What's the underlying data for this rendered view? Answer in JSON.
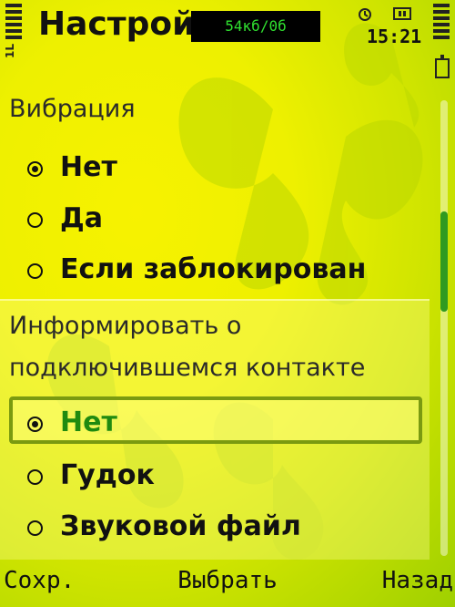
{
  "status": {
    "title": "Настройк",
    "traffic": "54кб/0б",
    "time": "15:21",
    "network": "1L"
  },
  "vibration": {
    "label": "Вибрация",
    "options": [
      {
        "label": "Нет",
        "selected": true
      },
      {
        "label": "Да",
        "selected": false
      },
      {
        "label": "Если заблокирован",
        "selected": false
      }
    ]
  },
  "notify": {
    "label_line1": "Информировать о",
    "label_line2": "подключившемся контакте",
    "options": [
      {
        "label": "Нет",
        "selected": true
      },
      {
        "label": "Гудок",
        "selected": false
      },
      {
        "label": "Звуковой файл",
        "selected": false
      }
    ]
  },
  "softkeys": {
    "left": "Сохр.",
    "middle": "Выбрать",
    "right": "Назад"
  },
  "colors": {
    "accent": "#1f8a10",
    "background": "#eef000"
  }
}
